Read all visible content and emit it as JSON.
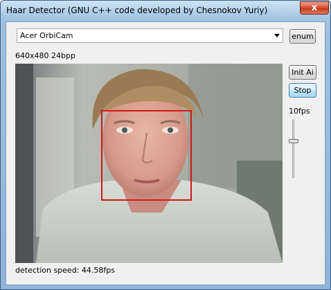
{
  "window": {
    "title": "Haar Detector (GNU C++ code developed by Chesnokov Yuriy)",
    "close_glyph": "x",
    "close_icon": "close-icon"
  },
  "camera": {
    "selected": "Acer OrbiCam",
    "enum_label": "enum"
  },
  "video": {
    "format": "640x480 24bpp",
    "detection_box_color": "#d01818"
  },
  "controls": {
    "init_label": "Init Ai",
    "stop_label": "Stop",
    "fps_label": "10fps",
    "fps_slider_level": 0.36
  },
  "status": {
    "speed": "detection speed: 44.58fps"
  }
}
